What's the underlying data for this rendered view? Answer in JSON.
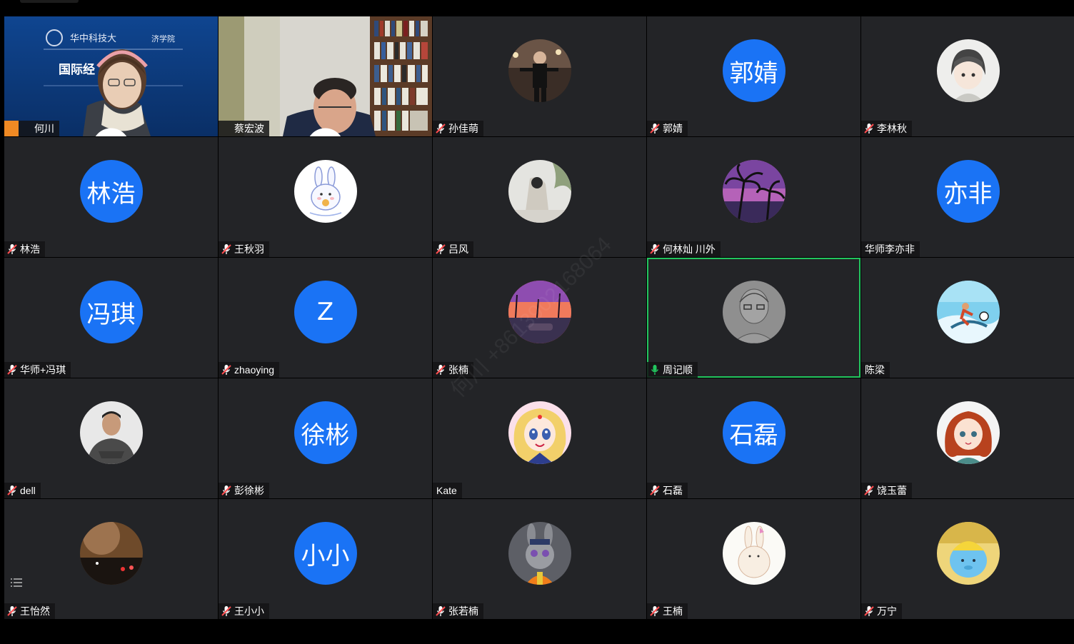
{
  "meeting": {
    "watermark": "何川 +8613902168064"
  },
  "colors": {
    "tile_bg": "#232427",
    "avatar_blue": "#1a73f5",
    "speaking_border": "#22c55e",
    "host_badge": "#f08a24",
    "muted_icon": "#ff4d4f"
  },
  "video_tiles": {
    "hechuan": {
      "name": "何川",
      "slide_text": "国际经",
      "slide_header": "华中科技大",
      "slide_header_right": "济学院"
    },
    "caihongbo": {
      "name": "蔡宏波"
    }
  },
  "participants": [
    {
      "name": "孙佳萌",
      "avatar_type": "image",
      "avatar_icon": "person-photo-icon"
    },
    {
      "name": "郭婧",
      "avatar_type": "text",
      "avatar_text": "郭婧"
    },
    {
      "name": "李林秋",
      "avatar_type": "image",
      "avatar_icon": "cartoon-boy-icon"
    },
    {
      "name": "林浩",
      "avatar_type": "text",
      "avatar_text": "林浩"
    },
    {
      "name": "王秋羽",
      "avatar_type": "image",
      "avatar_icon": "bunny-icon"
    },
    {
      "name": "吕风",
      "avatar_type": "image",
      "avatar_icon": "wall-photo-icon"
    },
    {
      "name": "何林灿 川外",
      "avatar_type": "image",
      "avatar_icon": "palm-trees-icon"
    },
    {
      "name": "华师李亦非",
      "avatar_type": "text",
      "avatar_text": "亦非"
    },
    {
      "name": "华师+冯琪",
      "avatar_type": "text",
      "avatar_text": "冯琪"
    },
    {
      "name": "zhaoying",
      "avatar_type": "text",
      "avatar_text": "Z"
    },
    {
      "name": "张楠",
      "avatar_type": "image",
      "avatar_icon": "sunset-icon"
    },
    {
      "name": "周记顺",
      "avatar_type": "image",
      "avatar_icon": "sketch-portrait-icon"
    },
    {
      "name": "陈梁",
      "avatar_type": "image",
      "avatar_icon": "surfer-icon"
    },
    {
      "name": "dell",
      "avatar_type": "image",
      "avatar_icon": "man-photo-icon"
    },
    {
      "name": "彭徐彬",
      "avatar_type": "text",
      "avatar_text": "徐彬"
    },
    {
      "name": "Kate",
      "avatar_type": "image",
      "avatar_icon": "anime-girl-icon"
    },
    {
      "name": "石磊",
      "avatar_type": "text",
      "avatar_text": "石磊"
    },
    {
      "name": "饶玉蕾",
      "avatar_type": "image",
      "avatar_icon": "cartoon-girl-icon"
    },
    {
      "name": "王怡然",
      "avatar_type": "image",
      "avatar_icon": "night-photo-icon"
    },
    {
      "name": "王小小",
      "avatar_type": "text",
      "avatar_text": "小小"
    },
    {
      "name": "张若楠",
      "avatar_type": "image",
      "avatar_icon": "bunny-cop-icon"
    },
    {
      "name": "王楠",
      "avatar_type": "image",
      "avatar_icon": "rabbit-drawing-icon"
    },
    {
      "name": "万宁",
      "avatar_type": "image",
      "avatar_icon": "blue-toy-icon"
    }
  ]
}
